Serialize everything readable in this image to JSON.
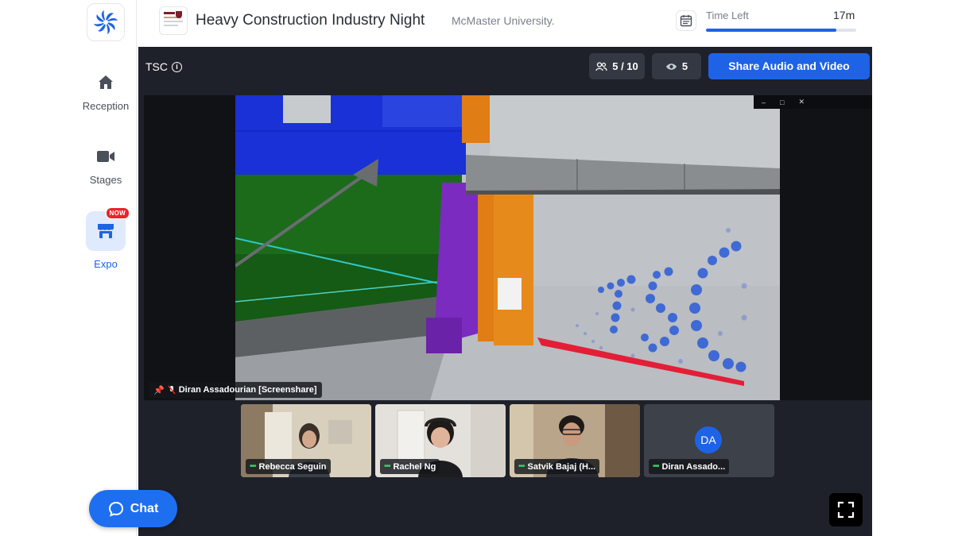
{
  "sidebar": {
    "logo_icon": "pinwheel-logo-icon",
    "items": [
      {
        "label": "Reception",
        "icon": "home-icon"
      },
      {
        "label": "Stages",
        "icon": "video-camera-icon"
      },
      {
        "label": "Expo",
        "icon": "booth-icon",
        "badge": "NOW",
        "active": true
      }
    ]
  },
  "header": {
    "title": "Heavy Construction Industry Night",
    "organization": "McMaster University.",
    "time_left_label": "Time Left",
    "time_left_value": "17m",
    "time_progress": 0.87
  },
  "stage": {
    "name": "TSC",
    "attendees": "5 / 10",
    "viewers": "5",
    "share_button": "Share Audio and Video",
    "presenter_label": "Diran Assadourian [Screenshare]",
    "screenshare_text": "TSC",
    "participants": [
      {
        "name": "Rebecca Seguin",
        "video": true
      },
      {
        "name": "Rachel Ng",
        "video": true
      },
      {
        "name": "Satvik Bajaj (H...",
        "video": true
      },
      {
        "name": "Diran Assado...",
        "video": false,
        "initials": "DA"
      }
    ]
  },
  "chat": {
    "label": "Chat"
  },
  "colors": {
    "accent": "#1e63e6",
    "stage_bg": "#1e2129",
    "badge_red": "#e8252b"
  }
}
